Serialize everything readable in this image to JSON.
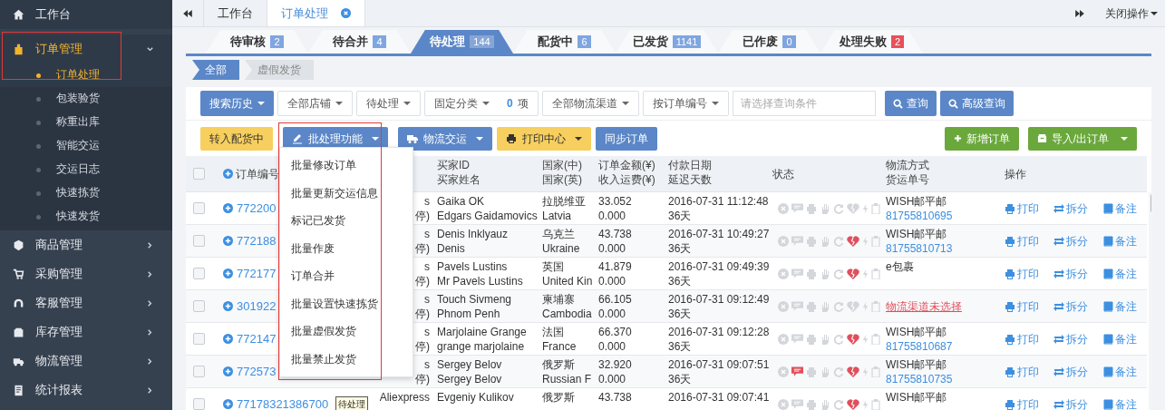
{
  "sidebar": {
    "items": [
      {
        "label": "工作台",
        "selected": false
      },
      {
        "label": "订单管理",
        "selected": true,
        "expanded": true,
        "children": [
          {
            "label": "订单处理",
            "selected": true
          },
          {
            "label": "包装验货",
            "selected": false
          },
          {
            "label": "称重出库",
            "selected": false
          },
          {
            "label": "智能交运",
            "selected": false
          },
          {
            "label": "交运日志",
            "selected": false
          },
          {
            "label": "快速拣货",
            "selected": false
          },
          {
            "label": "快速发货",
            "selected": false
          }
        ]
      },
      {
        "label": "商品管理",
        "selected": false,
        "expanded": false
      },
      {
        "label": "采购管理",
        "selected": false,
        "expanded": false
      },
      {
        "label": "客服管理",
        "selected": false,
        "expanded": false
      },
      {
        "label": "库存管理",
        "selected": false,
        "expanded": false
      },
      {
        "label": "物流管理",
        "selected": false,
        "expanded": false
      },
      {
        "label": "统计报表",
        "selected": false,
        "expanded": false
      }
    ]
  },
  "page_tabs": {
    "items": [
      {
        "label": "工作台",
        "selected": false,
        "closable": false
      },
      {
        "label": "订单处理",
        "selected": true,
        "closable": true
      }
    ],
    "close_all": "关闭操作"
  },
  "status_tabs": [
    {
      "label": "待审核",
      "count": "2",
      "color": "#7fa6e0",
      "selected": false
    },
    {
      "label": "待合并",
      "count": "4",
      "color": "#7fa6e0",
      "selected": false
    },
    {
      "label": "待处理",
      "count": "144",
      "color": "#86a6d6",
      "selected": true
    },
    {
      "label": "配货中",
      "count": "6",
      "color": "#7fa6e0",
      "selected": false
    },
    {
      "label": "已发货",
      "count": "1141",
      "color": "#7fa6e0",
      "selected": false
    },
    {
      "label": "已作废",
      "count": "0",
      "color": "#7fa6e0",
      "selected": false
    },
    {
      "label": "处理失败",
      "count": "2",
      "color": "#e8505b",
      "selected": false
    }
  ],
  "sub_tabs": [
    {
      "label": "全部",
      "selected": true
    },
    {
      "label": "虚假发货",
      "selected": false
    }
  ],
  "search_bar": {
    "history": "搜索历史",
    "filters": [
      "全部店铺",
      "待处理",
      "固定分类"
    ],
    "category_count": "0",
    "category_unit": "项",
    "filters_2": [
      "全部物流渠道",
      "按订单编号"
    ],
    "placeholder": "请选择查询条件",
    "search": "查询",
    "advanced": "高级查询"
  },
  "actions": [
    {
      "label": "转入配货中",
      "kind": "warning",
      "dropdown": false
    },
    {
      "label": "批处理功能",
      "kind": "primary",
      "dropdown": true
    },
    {
      "label": "物流交运",
      "kind": "primary",
      "dropdown": true
    },
    {
      "label": "打印中心",
      "kind": "warning",
      "dropdown": true
    },
    {
      "label": "同步订单",
      "kind": "primary",
      "dropdown": false
    }
  ],
  "actions_right": [
    {
      "label": "新增订单",
      "dropdown": false
    },
    {
      "label": "导入/出订单",
      "dropdown": true
    }
  ],
  "batch_menu": [
    "批量修改订单",
    "批量更新交运信息",
    "标记已发货",
    "批量作废",
    "订单合并",
    "批量设置快速拣货",
    "批量虚假发货",
    "批量禁止发货"
  ],
  "table": {
    "all_checked": false,
    "columns": {
      "order": "订单编号",
      "buyer": [
        "买家ID",
        "买家姓名"
      ],
      "country": [
        "国家(中)",
        "国家(英)"
      ],
      "amount": [
        "订单金额(¥)",
        "收入运费(¥)"
      ],
      "date": [
        "付款日期",
        "延迟天数"
      ],
      "status": "状态",
      "logistics": [
        "物流方式",
        "货运单号"
      ],
      "ops": "操作"
    },
    "rows": [
      {
        "checked": false,
        "order": "772200",
        "badge": "",
        "store": [
          "s",
          "停)"
        ],
        "buyer": [
          "Gaika OK",
          "Edgars Gaidamovics"
        ],
        "country": [
          "拉脱维亚",
          "Latvia"
        ],
        "amount": [
          "33.052",
          "0.000"
        ],
        "date": [
          "2016-07-31 11:12:48",
          "36天"
        ],
        "message_on": false,
        "heart_on": false,
        "logistics": {
          "kind": "shipping",
          "method": "WISH邮平邮",
          "tracking": "81755810695"
        },
        "ops": [
          "打印",
          "拆分",
          "备注"
        ]
      },
      {
        "checked": false,
        "order": "772188",
        "badge": "",
        "store": [
          "s",
          "停)"
        ],
        "buyer": [
          "Denis Inklyauz",
          "Denis"
        ],
        "country": [
          "乌克兰",
          "Ukraine"
        ],
        "amount": [
          "43.738",
          "0.000"
        ],
        "date": [
          "2016-07-31 10:49:27",
          "36天"
        ],
        "message_on": false,
        "heart_on": true,
        "logistics": {
          "kind": "shipping",
          "method": "WISH邮平邮",
          "tracking": "81755810713"
        },
        "ops": [
          "打印",
          "拆分",
          "备注"
        ]
      },
      {
        "checked": false,
        "order": "772177",
        "badge": "",
        "store": [
          "s",
          "停)"
        ],
        "buyer": [
          "Pavels Lustins",
          "Mr Pavels Lustins"
        ],
        "country": [
          "英国",
          "United Kin"
        ],
        "amount": [
          "41.879",
          "0.000"
        ],
        "date": [
          "2016-07-31 09:49:39",
          "36天"
        ],
        "message_on": false,
        "heart_on": true,
        "logistics": {
          "kind": "shipping",
          "method": "e包裹"
        },
        "ops": [
          "打印",
          "拆分",
          "备注"
        ]
      },
      {
        "checked": false,
        "order": "301922",
        "badge": "",
        "store": [
          "s",
          "停)"
        ],
        "buyer": [
          "Touch Sivmeng",
          "Phnom Penh"
        ],
        "country": [
          "柬埔寨",
          "Cambodia"
        ],
        "amount": [
          "66.105",
          "0.000"
        ],
        "date": [
          "2016-07-31 09:12:49",
          "36天"
        ],
        "message_on": false,
        "heart_on": false,
        "logistics": {
          "kind": "unselected",
          "method": "物流渠道未选择"
        },
        "ops": [
          "打印",
          "拆分",
          "备注"
        ]
      },
      {
        "checked": false,
        "order": "772147",
        "badge": "",
        "store": [
          "s",
          "停)"
        ],
        "buyer": [
          "Marjolaine Grange",
          "grange marjolaine"
        ],
        "country": [
          "法国",
          "France"
        ],
        "amount": [
          "66.370",
          "0.000"
        ],
        "date": [
          "2016-07-31 09:12:28",
          "36天"
        ],
        "message_on": false,
        "heart_on": true,
        "logistics": {
          "kind": "shipping",
          "method": "WISH邮平邮",
          "tracking": "81755810687"
        },
        "ops": [
          "打印",
          "拆分",
          "备注"
        ]
      },
      {
        "checked": false,
        "order": "772573",
        "badge": "",
        "store": [
          "s",
          "停)"
        ],
        "buyer": [
          "Sergey Belov",
          "Sergey Belov"
        ],
        "country": [
          "俄罗斯",
          "Russian F"
        ],
        "amount": [
          "32.920",
          "0.000"
        ],
        "date": [
          "2016-07-31 09:07:51",
          "36天"
        ],
        "message_on": true,
        "heart_on": true,
        "logistics": {
          "kind": "shipping",
          "method": "WISH邮平邮",
          "tracking": "81755810735"
        },
        "ops": [
          "打印",
          "拆分",
          "备注"
        ]
      },
      {
        "checked": false,
        "order": "77178321386700",
        "badge": "待处理",
        "store": [
          "Aliexpress"
        ],
        "buyer": [
          "Evgeniy Kulikov"
        ],
        "country": [
          "俄罗斯"
        ],
        "amount": [
          "43.738"
        ],
        "date": [
          "2016-07-31 09:07:41"
        ],
        "message_on": false,
        "heart_on": true,
        "logistics": {
          "kind": "shipping",
          "method": "WISH邮平邮"
        },
        "ops": [
          "打印",
          "拆分",
          "备注"
        ]
      }
    ]
  }
}
